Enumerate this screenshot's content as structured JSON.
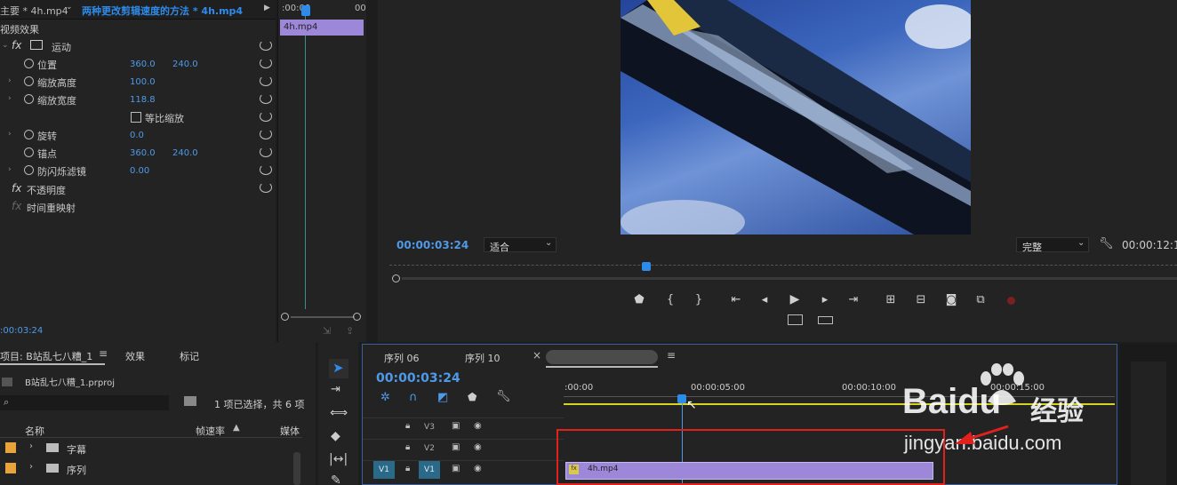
{
  "effect_controls": {
    "source_label": "主要 * 4h.mp4",
    "sequence_label": "两种更改剪辑速度的方法 * 4h.mp4",
    "mini_timeline_time_start": ":00:00",
    "mini_timeline_time_end": "00",
    "mini_clip_label": "4h.mp4",
    "section_title": "视频效果",
    "motion_label": "运动",
    "properties": [
      {
        "label": "位置",
        "v1": "360.0",
        "v2": "240.0"
      },
      {
        "label": "缩放高度",
        "v1": "100.0",
        "v2": ""
      },
      {
        "label": "缩放宽度",
        "v1": "118.8",
        "v2": ""
      },
      {
        "label": "旋转",
        "v1": "0.0",
        "v2": ""
      },
      {
        "label": "锚点",
        "v1": "360.0",
        "v2": "240.0"
      },
      {
        "label": "防闪烁滤镜",
        "v1": "0.00",
        "v2": ""
      }
    ],
    "uniform_scale_label": "等比缩放",
    "opacity_label": "不透明度",
    "time_remap_label": "时间重映射",
    "timecode": ":00:03:24"
  },
  "program_monitor": {
    "timecode": "00:00:03:24",
    "fit_label": "适合",
    "quality_label": "完整",
    "duration": "00:00:12:1"
  },
  "project": {
    "tab_project": "项目: B站乱七八糟_1",
    "tab_effects": "效果",
    "tab_markers": "标记",
    "file_name": "B站乱七八糟_1.prproj",
    "selection_status": "1 项已选择，共 6 项",
    "col_name": "名称",
    "col_framerate": "帧速率",
    "col_media": "媒体",
    "items": [
      {
        "label": "字幕",
        "color": "#e8a33a"
      },
      {
        "label": "序列",
        "color": "#e8a33a"
      }
    ]
  },
  "timeline": {
    "tabs": [
      "序列 06",
      "序列 10"
    ],
    "timecode": "00:00:03:24",
    "ruler": [
      ":00:00",
      "00:00:05:00",
      "00:00:10:00",
      "00:00:15:00"
    ],
    "tracks": [
      {
        "name": "V3",
        "source": ""
      },
      {
        "name": "V2",
        "source": ""
      },
      {
        "name": "V1",
        "source": "V1"
      }
    ],
    "clip_label": "4h.mp4",
    "clip_fx": "fx"
  },
  "watermark": {
    "brand": "Baidu",
    "brand_cn": "经验",
    "url": "jingyan.baidu.com"
  },
  "colors": {
    "accent_blue": "#2d8ceb",
    "clip_purple": "#9d87d8",
    "highlight_red": "#e0211d",
    "work_area_yellow": "#d7d321"
  }
}
